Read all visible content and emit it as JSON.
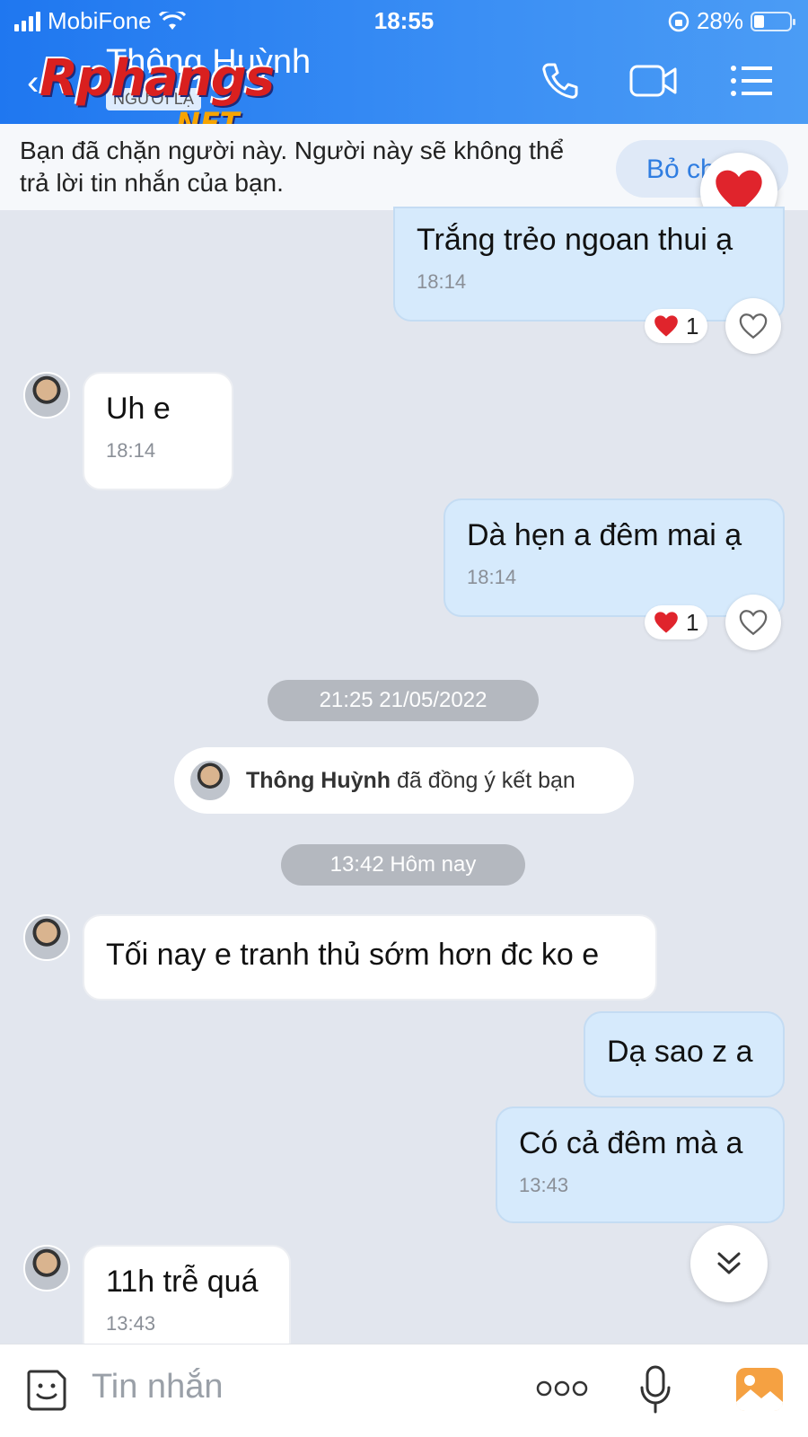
{
  "status_bar": {
    "carrier": "MobiFone",
    "time": "18:55",
    "battery": "28%",
    "battery_level": 0.28
  },
  "header": {
    "title": "Thông Huỳnh",
    "subtitle": "NGƯỜI LẠ",
    "icons": [
      "back-icon",
      "phone-icon",
      "video-icon",
      "menu-icon"
    ]
  },
  "watermark": {
    "main": "Rphangs",
    "sub": ".NET"
  },
  "block_banner": {
    "text": "Bạn đã chặn người này. Người này sẽ không thể trả lời tin nhắn của bạn.",
    "button": "Bỏ ch"
  },
  "messages": [
    {
      "from": "me",
      "text": "Trắng trẻo ngoan thui ạ",
      "time": "18:14",
      "reaction_count": "1"
    },
    {
      "from": "them",
      "text": "Uh e",
      "time": "18:14"
    },
    {
      "from": "me",
      "text": "Dà hẹn a đêm mai ạ",
      "time": "18:14",
      "reaction_count": "1"
    },
    {
      "from": "them",
      "text": "Tối nay e tranh thủ sớm hơn đc ko e"
    },
    {
      "from": "me",
      "text": "Dạ sao z a"
    },
    {
      "from": "me",
      "text": "Có cả đêm mà a",
      "time": "13:43"
    },
    {
      "from": "them",
      "text": "11h trễ quá",
      "time": "13:43"
    }
  ],
  "timestamps": {
    "first": "21:25 21/05/2022",
    "second": "13:42 Hôm nay"
  },
  "system_message": {
    "name": "Thông Huỳnh",
    "text": "đã đồng ý kết bạn"
  },
  "composer": {
    "placeholder": "Tin nhắn"
  },
  "colors": {
    "header": "#2a84f2",
    "my_bubble": "#d6eafc",
    "their_bubble": "#ffffff",
    "heart": "#e0242c"
  }
}
